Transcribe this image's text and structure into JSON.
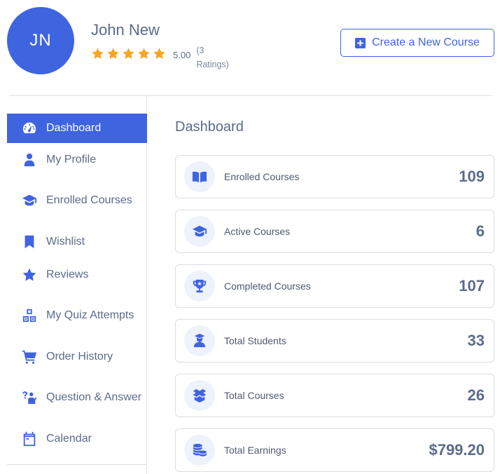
{
  "profile": {
    "initials": "JN",
    "name": "John New",
    "rating_value": "5.00",
    "rating_count": "(3 Ratings)",
    "stars": 5
  },
  "header": {
    "create_course_label": "Create a New Course"
  },
  "sidebar": {
    "items": [
      {
        "label": "Dashboard",
        "icon": "dashboard-gauge-icon",
        "active": true
      },
      {
        "label": "My Profile",
        "icon": "user-icon"
      },
      {
        "label": "Enrolled Courses",
        "icon": "graduation-cap-icon"
      },
      {
        "label": "Wishlist",
        "icon": "bookmark-icon"
      },
      {
        "label": "Reviews",
        "icon": "star-icon"
      },
      {
        "label": "My Quiz Attempts",
        "icon": "quiz-blocks-icon"
      },
      {
        "label": "Order History",
        "icon": "cart-icon"
      },
      {
        "label": "Question & Answer",
        "icon": "question-person-icon"
      },
      {
        "label": "Calendar",
        "icon": "calendar-icon"
      }
    ]
  },
  "main": {
    "title": "Dashboard",
    "cards": [
      {
        "label": "Enrolled Courses",
        "value": "109",
        "icon": "book-open-icon"
      },
      {
        "label": "Active Courses",
        "value": "6",
        "icon": "graduation-cap-icon"
      },
      {
        "label": "Completed Courses",
        "value": "107",
        "icon": "trophy-icon"
      },
      {
        "label": "Total Students",
        "value": "33",
        "icon": "student-icon"
      },
      {
        "label": "Total Courses",
        "value": "26",
        "icon": "box-icon"
      },
      {
        "label": "Total Earnings",
        "value": "$799.20",
        "icon": "coins-icon"
      }
    ]
  },
  "colors": {
    "accent": "#3f64e0",
    "star": "#f5a623",
    "text": "#5b6b8c",
    "border": "#d9dde4"
  }
}
